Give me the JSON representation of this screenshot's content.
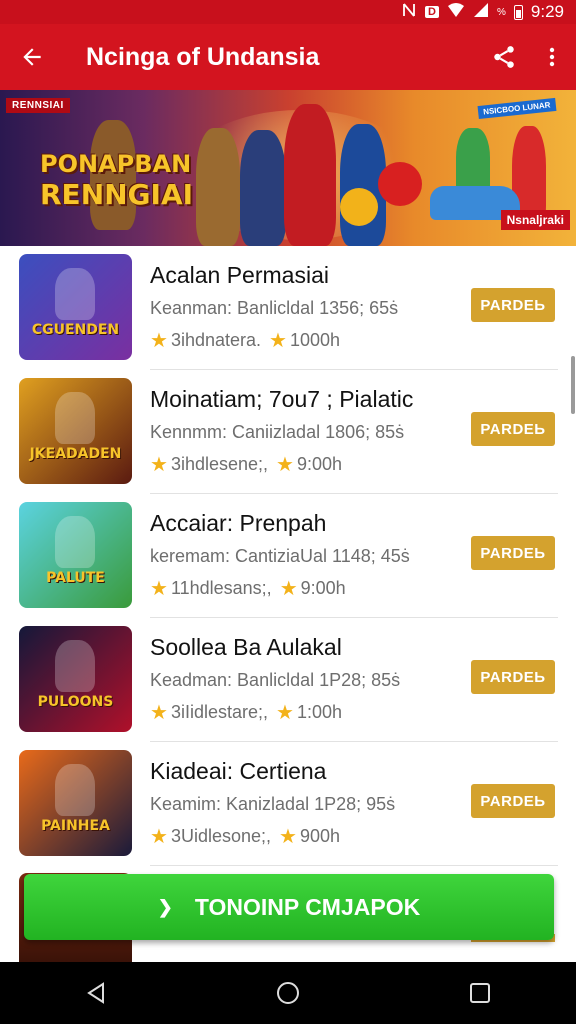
{
  "status_bar": {
    "time": "9:29",
    "badge": "D",
    "battery_pct": "%",
    "icons": [
      "nfc-icon",
      "wifi-icon",
      "signal-icon",
      "battery-icon"
    ]
  },
  "app_bar": {
    "title": "Ncinga of Undansia",
    "icons": [
      "arrow-back-icon",
      "share-icon",
      "more-vert-icon"
    ]
  },
  "banner": {
    "tag_left": "RENNSIAI",
    "headline_line1": "PONAPBAN",
    "headline_line2": "RENNGIAI",
    "tag_right": "Nsnaljraki",
    "tag_right_top": "NSICBOO LUNAR"
  },
  "games": [
    {
      "name": "Acalan Permasiai",
      "meta": "Keanman: Banlicldal 1356; 65ṡ",
      "rating_label": "3ihdnatera.",
      "time": "1000h",
      "button": "PARDEЬ",
      "thumb_label": "CGUENDEN",
      "thumb_colors": [
        "#3b4fbf",
        "#7a2fa0"
      ]
    },
    {
      "name": "Moinatiam; 7ou7 ; Pialatic",
      "meta": "Kennmm: Caniizladal 1806; 85ṡ",
      "rating_label": "3ihdlesene;,",
      "time": "9:00h",
      "button": "PARDEЬ",
      "thumb_label": "JKEADADEN",
      "thumb_colors": [
        "#e0a020",
        "#5a1a10"
      ]
    },
    {
      "name": "Accaiar: Prenpah",
      "meta": "keremam: CantiziaUal 1148; 45ṡ",
      "rating_label": "11hdlesans;,",
      "time": "9:00h",
      "button": "PARDEЬ",
      "thumb_label": "PALUTE",
      "thumb_colors": [
        "#5bd3e0",
        "#3a9a3a"
      ]
    },
    {
      "name": "Soollea Ba Aulakal",
      "meta": "Keadman: Banlicldal 1P28; 85ṡ",
      "rating_label": "3iIidlestare;,",
      "time": "1:00h",
      "button": "PARDEЬ",
      "thumb_label": "PULOONS",
      "thumb_colors": [
        "#14183a",
        "#b0102a"
      ]
    },
    {
      "name": "Kiadeai: Certiena",
      "meta": "Keamim: Kanizladal 1P28; 95ṡ",
      "rating_label": "3Uidlesone;,",
      "time": "900h",
      "button": "PARDEЬ",
      "thumb_label": "PAINHEA",
      "thumb_colors": [
        "#e86a1a",
        "#1a1a3a"
      ]
    }
  ],
  "cta": {
    "label": "TONOINP CMJAPOK"
  },
  "nav_bar": {
    "icons": [
      "back-triangle-icon",
      "home-circle-icon",
      "recents-square-icon"
    ]
  },
  "colors": {
    "app_bar": "#d3141f",
    "status_bar": "#c8101c",
    "button_gold": "#d4a22e",
    "cta_green": "#2fc42d",
    "star": "#f3b21a"
  }
}
